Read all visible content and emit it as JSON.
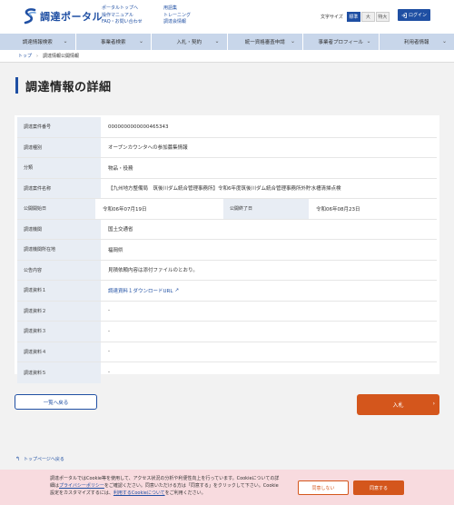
{
  "header": {
    "logo_text": "調達ポータル",
    "links_col1": [
      "ポータルトップへ",
      "操作マニュアル",
      "FAQ・お問い合わせ"
    ],
    "links_col2": [
      "用語集",
      "トレーニング",
      "調達会情報"
    ],
    "font_size_label": "文字サイズ",
    "font_sizes": [
      "標準",
      "大",
      "特大"
    ],
    "login_label": "ログイン",
    "accent": "#1f4fa3"
  },
  "nav": {
    "items": [
      "調達情報検索",
      "事業者検索",
      "入札・契約",
      "統一資格審査申請",
      "事業者プロフィール",
      "利用者情報"
    ]
  },
  "breadcrumb": {
    "home": "トップ",
    "current": "調達情報公開情報"
  },
  "page_title": "調達情報の詳細",
  "detail": {
    "case_number_label": "調達案件番号",
    "case_number": "0000000000000465343",
    "type_label": "調達種別",
    "type": "オープンカウンタへの参加募集情報",
    "category_label": "分類",
    "category": "物品・役務",
    "name_label": "調達案件名称",
    "name": "【九州地方整備局　筑後川ダム統合管理事務所】令和6年度筑後川ダム統合管理事務所外貯水槽清掃点検",
    "start_label": "公開開始日",
    "start": "令和06年07月19日",
    "end_label": "公開終了日",
    "end": "令和06年08月23日",
    "org_label": "調達機関",
    "org": "国土交通省",
    "location_label": "調達機関所在地",
    "location": "福岡県",
    "notice_label": "公告内容",
    "notice": "見積依頼内容は添付ファイルのとおり。",
    "doc1_label": "調達資料１",
    "doc1": "調達資料１ダウンロードURL",
    "doc2_label": "調達資料２",
    "doc2": "-",
    "doc3_label": "調達資料３",
    "doc3": "-",
    "doc4_label": "調達資料４",
    "doc4": "-",
    "doc5_label": "調達資料５",
    "doc5": "-"
  },
  "buttons": {
    "back": "一覧へ戻る",
    "bid": "入札",
    "bid_color": "#d4561c"
  },
  "toplink": "トップページへ戻る",
  "cookie": {
    "line1": "調達ポータルではCookie等を使用して、アクセス状況の分析や利便性向上を行っています。Cookieについての詳",
    "line2_pre": "細は",
    "line2_link": "プライバシーポリシー",
    "line2_post": "をご確認ください。同意いただける方は「同意する」をクリックして下さい。Cookie",
    "line3_pre": "設定をカスタマイズするには、",
    "line3_link": "利用するCookieについて",
    "line3_post": "をご利用ください。",
    "decline": "同意しない",
    "agree": "同意する",
    "bg": "#f8dbdf"
  }
}
